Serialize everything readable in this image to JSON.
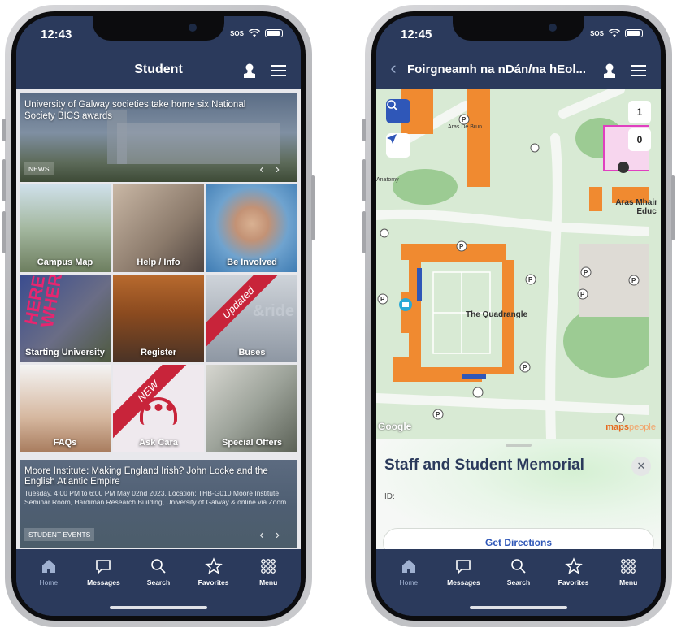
{
  "left_phone": {
    "time": "12:43",
    "sos": "SOS",
    "header_title": "Student",
    "news": {
      "text": "University of Galway societies take home six National Society BICS awards",
      "tag": "NEWS"
    },
    "tiles": [
      {
        "label": "Campus Map"
      },
      {
        "label": "Help / Info"
      },
      {
        "label": "Be Involved"
      },
      {
        "label": "Starting University",
        "overlay": "HERE IS WHERE"
      },
      {
        "label": "Register"
      },
      {
        "label": "Buses",
        "ribbon": "Updated",
        "overlay": "&ride"
      },
      {
        "label": "FAQs"
      },
      {
        "label": "Ask Cara",
        "ribbon": "NEW"
      },
      {
        "label": "Special Offers"
      }
    ],
    "event": {
      "title": "Moore Institute: Making England Irish? John Locke and the English Atlantic Empire",
      "details": "Tuesday, 4:00 PM to 6:00 PM May 02nd 2023. Location: THB-G010 Moore Institute Seminar Room, Hardiman Research Building, University of Galway & online via Zoom",
      "tag": "STUDENT EVENTS"
    }
  },
  "right_phone": {
    "time": "12:45",
    "sos": "SOS",
    "header_title": "Foirgneamh na nDán/na hEol...",
    "map": {
      "quad_label": "The Quadrangle",
      "aras_mhaire": "Aras Mhair",
      "edu": "Educ",
      "aras_de_brun": "Aras De Brun",
      "anatomy": "Anatomy",
      "google": "Google",
      "mapspeople_a": "maps",
      "mapspeople_b": "people",
      "floors": [
        "1",
        "0"
      ]
    },
    "sheet": {
      "title": "Staff and Student Memorial",
      "id_label": "ID:",
      "directions_label": "Get Directions"
    }
  },
  "tabs": [
    {
      "label": "Home",
      "icon": "home-icon"
    },
    {
      "label": "Messages",
      "icon": "message-icon"
    },
    {
      "label": "Search",
      "icon": "search-icon"
    },
    {
      "label": "Favorites",
      "icon": "star-icon"
    },
    {
      "label": "Menu",
      "icon": "grid-menu-icon"
    }
  ],
  "colors": {
    "navy": "#2b3a5c",
    "accent_blue": "#2f57b8",
    "building_orange": "#f08a30",
    "ribbon_red": "#c8243a"
  }
}
